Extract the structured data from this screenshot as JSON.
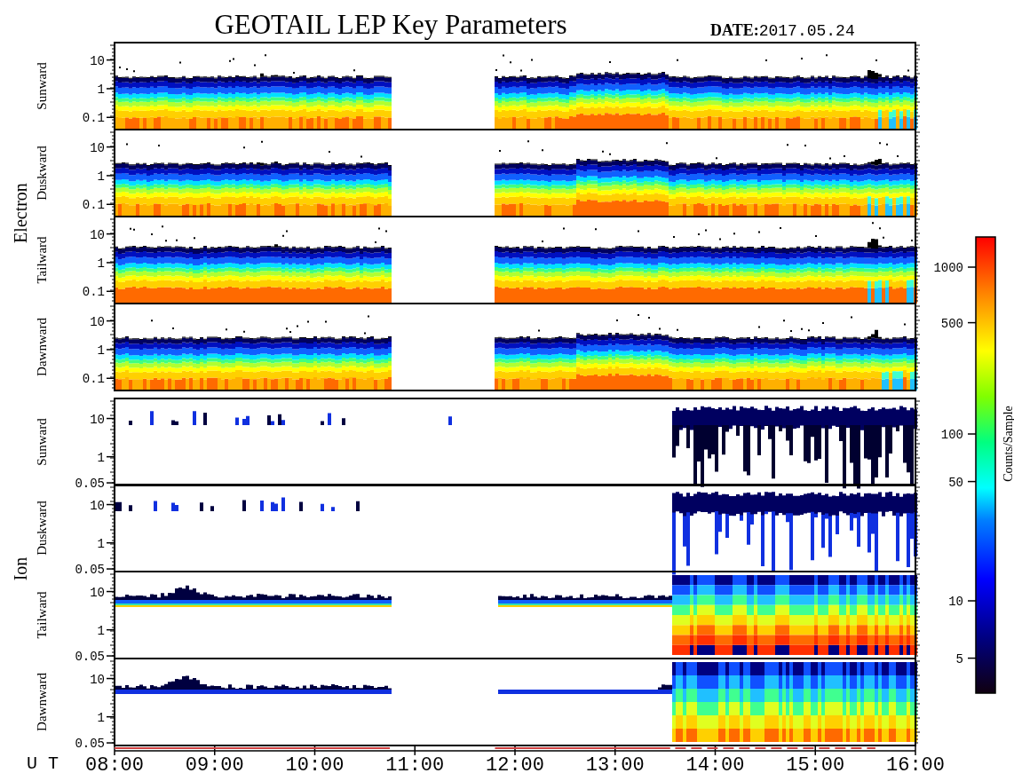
{
  "title": "GEOTAIL LEP Key Parameters",
  "date_label": "DATE:",
  "date": "2017.05.24",
  "groups": [
    {
      "label": "Electron",
      "kind": "electron",
      "panels": [
        {
          "label": "Sunward",
          "yticks": [
            "10",
            "1",
            "0.1"
          ]
        },
        {
          "label": "Duskward",
          "yticks": [
            "10",
            "1",
            "0.1"
          ]
        },
        {
          "label": "Tailward",
          "yticks": [
            "10",
            "1",
            "0.1"
          ]
        },
        {
          "label": "Dawnward",
          "yticks": [
            "10",
            "1",
            "0.1"
          ]
        }
      ]
    },
    {
      "label": "Ion",
      "kind": "ion",
      "panels": [
        {
          "label": "Sunward",
          "yticks": [
            "10",
            "1",
            "0.05"
          ]
        },
        {
          "label": "Duskward",
          "yticks": [
            "10",
            "1",
            "0.05"
          ]
        },
        {
          "label": "Tailward",
          "yticks": [
            "10",
            "1",
            "0.05"
          ]
        },
        {
          "label": "Dawnward",
          "yticks": [
            "10",
            "1",
            "0.05"
          ]
        }
      ]
    }
  ],
  "x_axis": {
    "label": "U T",
    "ticks": [
      "08:00",
      "09:00",
      "10:00",
      "11:00",
      "12:00",
      "13:00",
      "14:00",
      "15:00",
      "16:00"
    ]
  },
  "colorbar": {
    "title": "Counts/Sample",
    "ticks": [
      "1000",
      "500",
      "100",
      "50",
      "10",
      "5"
    ]
  }
}
